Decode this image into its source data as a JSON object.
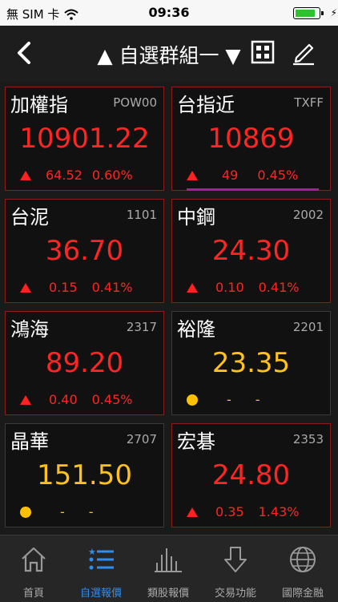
{
  "status": {
    "carrier": "無 SIM 卡",
    "time": "09:36"
  },
  "nav": {
    "title": "▲ 自選群組一 ▼"
  },
  "tiles": [
    {
      "name": "加權指",
      "code": "POW00",
      "price": "10901.22",
      "change": "64.52",
      "pct": "0.60%",
      "color": "red",
      "trend": "up"
    },
    {
      "name": "台指近",
      "code": "TXFF",
      "price": "10869",
      "change": "49",
      "pct": "0.45%",
      "color": "red",
      "trend": "up"
    },
    {
      "name": "台泥",
      "code": "1101",
      "price": "36.70",
      "change": "0.15",
      "pct": "0.41%",
      "color": "red",
      "trend": "up"
    },
    {
      "name": "中鋼",
      "code": "2002",
      "price": "24.30",
      "change": "0.10",
      "pct": "0.41%",
      "color": "red",
      "trend": "up"
    },
    {
      "name": "鴻海",
      "code": "2317",
      "price": "89.20",
      "change": "0.40",
      "pct": "0.45%",
      "color": "red",
      "trend": "up"
    },
    {
      "name": "裕隆",
      "code": "2201",
      "price": "23.35",
      "change": "-",
      "pct": "-",
      "color": "yellow",
      "trend": "flat"
    },
    {
      "name": "晶華",
      "code": "2707",
      "price": "151.50",
      "change": "-",
      "pct": "-",
      "color": "yellow",
      "trend": "flat"
    },
    {
      "name": "宏碁",
      "code": "2353",
      "price": "24.80",
      "change": "0.35",
      "pct": "1.43%",
      "color": "red",
      "trend": "up"
    }
  ],
  "tabs": [
    {
      "label": "首頁",
      "icon": "home-icon"
    },
    {
      "label": "自選報價",
      "icon": "list-icon",
      "active": true
    },
    {
      "label": "類股報價",
      "icon": "bar-chart-icon"
    },
    {
      "label": "交易功能",
      "icon": "down-arrow-icon"
    },
    {
      "label": "國際金融",
      "icon": "globe-icon"
    }
  ],
  "colors": {
    "up": "#ff2525",
    "flat": "#ffc21a",
    "accent": "#2e8ef0"
  }
}
